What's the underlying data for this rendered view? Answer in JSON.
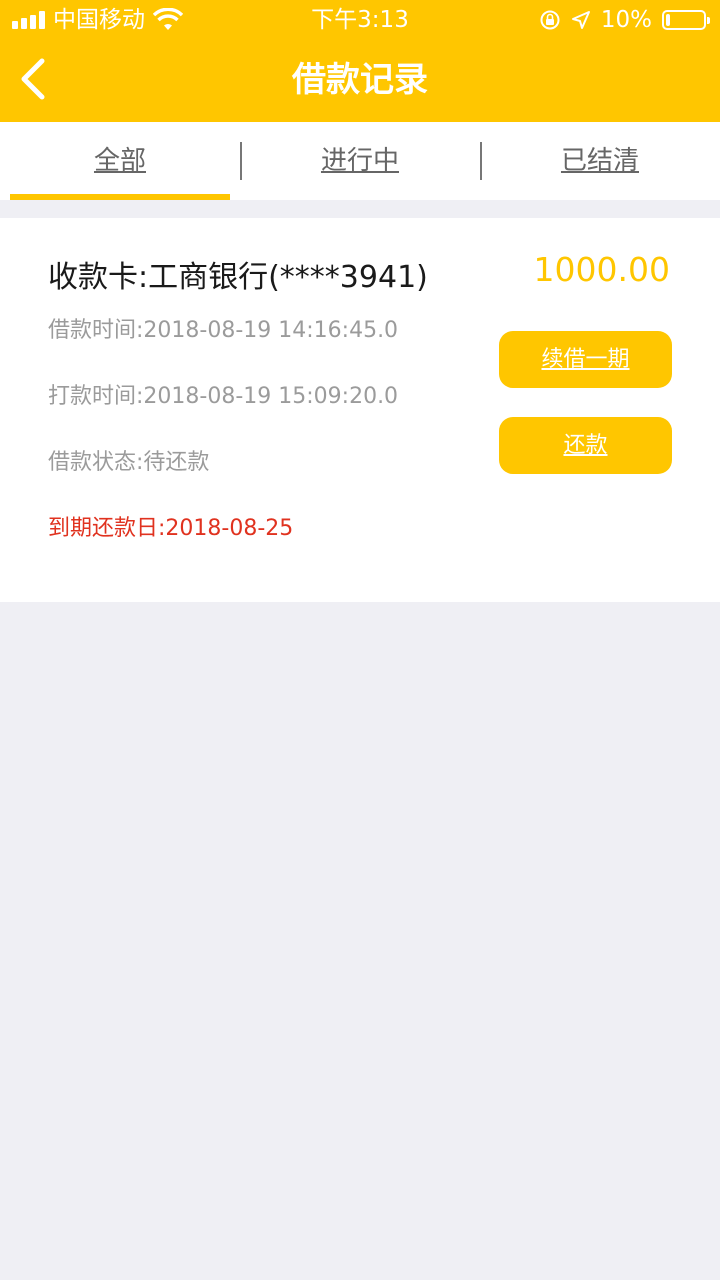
{
  "status_bar": {
    "carrier": "中国移动",
    "time": "下午3:13",
    "battery_text": "10%",
    "battery_level": 0.1,
    "icons": [
      "signal-icon",
      "wifi-icon",
      "orientation-lock-icon",
      "location-arrow-icon",
      "battery-icon"
    ]
  },
  "nav": {
    "title": "借款记录",
    "back_icon": "chevron-left-icon"
  },
  "tabs": [
    {
      "label": "全部",
      "active": true
    },
    {
      "label": "进行中",
      "active": false
    },
    {
      "label": "已结清",
      "active": false
    }
  ],
  "record": {
    "card_label": "收款卡:工商银行(****3941)",
    "amount": "1000.00",
    "borrow_time": "借款时间:2018-08-19 14:16:45.0",
    "payout_time": "打款时间:2018-08-19 15:09:20.0",
    "status": "借款状态:待还款",
    "due_date": "到期还款日:2018-08-25",
    "renew_button": "续借一期",
    "repay_button": "还款"
  },
  "colors": {
    "brand": "#ffc600",
    "background": "#efeff4",
    "due_text": "#e0321f",
    "secondary_text": "#9b9b9b"
  }
}
